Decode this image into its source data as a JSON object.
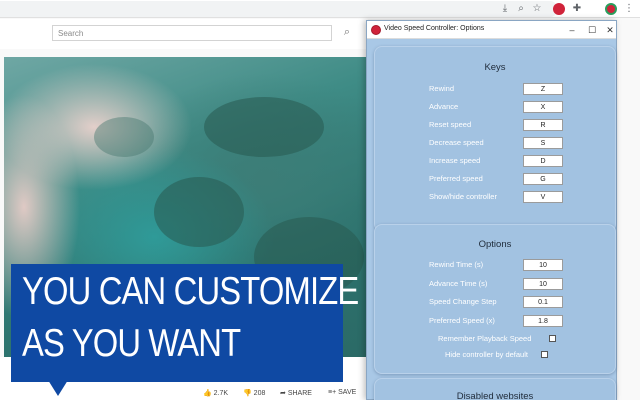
{
  "page": {
    "search_placeholder": "Search"
  },
  "browser": {
    "toolbar_icons": [
      "download-icon",
      "zoom-icon",
      "star-icon",
      "video-speed-extension-icon",
      "puzzle-icon",
      "profile-icon",
      "menu-icon"
    ]
  },
  "banner": {
    "line1": "YOU CAN CUSTOMIZE",
    "line2": "AS YOU WANT",
    "color": "#0f49a3"
  },
  "video_actions": {
    "likes": "2.7K",
    "dislikes": "208",
    "share": "SHARE",
    "save": "SAVE"
  },
  "options_window": {
    "title": "Video Speed Controller: Options",
    "keys_section": {
      "title": "Keys",
      "rows": [
        {
          "label": "Rewind",
          "key": "Z"
        },
        {
          "label": "Advance",
          "key": "X"
        },
        {
          "label": "Reset speed",
          "key": "R"
        },
        {
          "label": "Decrease speed",
          "key": "S"
        },
        {
          "label": "Increase speed",
          "key": "D"
        },
        {
          "label": "Preferred speed",
          "key": "G"
        },
        {
          "label": "Show/hide controller",
          "key": "V"
        }
      ]
    },
    "options_section": {
      "title": "Options",
      "rows": [
        {
          "label": "Rewind Time (s)",
          "value": "10"
        },
        {
          "label": "Advance Time (s)",
          "value": "10"
        },
        {
          "label": "Speed Change Step",
          "value": "0.1"
        },
        {
          "label": "Preferred Speed (x)",
          "value": "1.8"
        }
      ],
      "checkboxes": [
        {
          "label": "Remember Playback Speed",
          "checked": false
        },
        {
          "label": "Hide controller by default",
          "checked": false
        }
      ]
    },
    "disabled_section": {
      "title": "Disabled websites"
    }
  }
}
